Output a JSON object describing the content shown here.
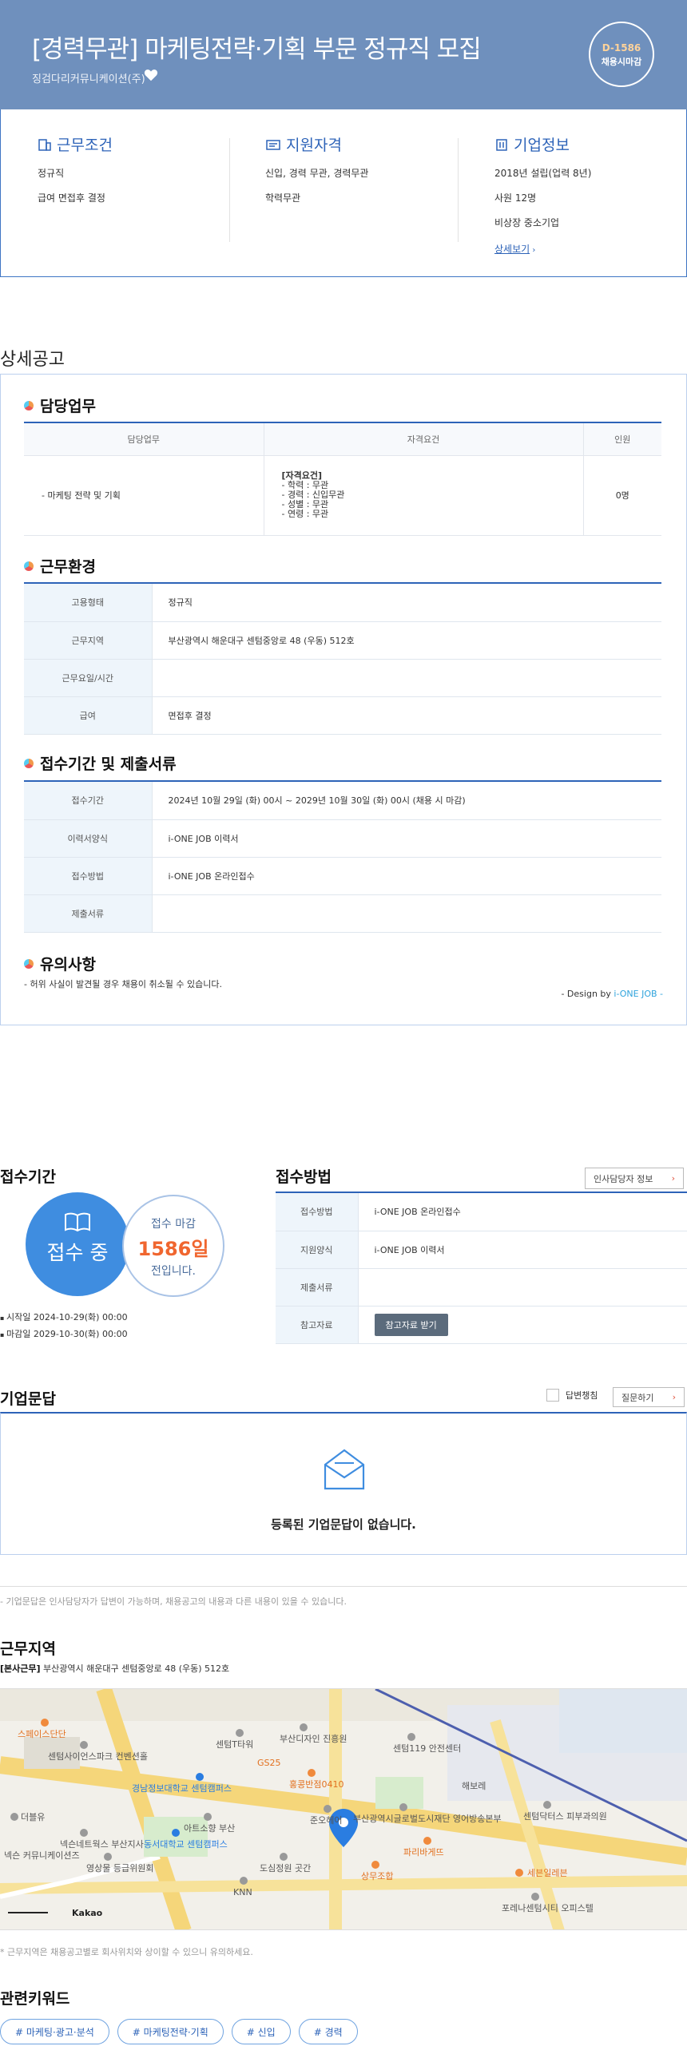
{
  "header": {
    "title": "[경력무관] 마케팅전략·기획 부문 정규직 모집",
    "company": "징검다리커뮤니케이션(주)",
    "dday": "D-1586",
    "dday_label": "채용시마감"
  },
  "summary": {
    "work": {
      "title": "근무조건",
      "lines": [
        "정규직",
        "급여 면접후 결정"
      ]
    },
    "qualification": {
      "title": "지원자격",
      "lines": [
        "신입, 경력 무관, 경력무관",
        "학력무관"
      ]
    },
    "company_info": {
      "title": "기업정보",
      "lines": [
        "2018년 설립(업력 8년)",
        "사원 12명",
        "비상장 중소기업"
      ],
      "link": "상세보기"
    }
  },
  "detail": {
    "section_title": "상세공고",
    "duties": {
      "title": "담당업무",
      "headers": [
        "담당업무",
        "자격요건",
        "인원"
      ],
      "row": {
        "duty": "- 마케팅 전략 및 기획",
        "req_title": "[자격요건]",
        "req_lines": [
          "- 학력 : 무관",
          "- 경력 : 신입무관",
          "- 성별 : 무관",
          "- 연령 : 무관"
        ],
        "count": "0명"
      }
    },
    "environment": {
      "title": "근무환경",
      "rows": [
        {
          "label": "고용형태",
          "value": "정규직"
        },
        {
          "label": "근무지역",
          "value": "부산광역시 해운대구 센텀중앙로 48 (우동) 512호"
        },
        {
          "label": "근무요일/시간",
          "value": ""
        },
        {
          "label": "급여",
          "value": "면접후 결정"
        }
      ]
    },
    "documents": {
      "title": "접수기간 및 제출서류",
      "rows": [
        {
          "label": "접수기간",
          "value": "2024년 10월 29일 (화) 00시 ~ 2029년 10월 30일 (화) 00시 (채용 시 마감)"
        },
        {
          "label": "이력서양식",
          "value": "i-ONE JOB 이력서"
        },
        {
          "label": "접수방법",
          "value": "i-ONE JOB 온라인접수"
        },
        {
          "label": "제출서류",
          "value": ""
        }
      ]
    },
    "caution": {
      "title": "유의사항",
      "text": "- 허위 사실이 발견될 경우 채용이 취소될 수 있습니다."
    },
    "design_prefix": "- Design by ",
    "design_brand": "i-ONE JOB -"
  },
  "apply": {
    "period_title": "접수기간",
    "status": "접수 중",
    "deadline_label": "접수 마감",
    "deadline_days": "1586일",
    "deadline_suffix": "전입니다.",
    "start": "시작일 2024-10-29(화) 00:00",
    "end": "마감일 2029-10-30(화) 00:00",
    "method_title": "접수방법",
    "contact_button": "인사담당자 정보",
    "rows": [
      {
        "label": "접수방법",
        "value": "i-ONE JOB 온라인접수"
      },
      {
        "label": "지원양식",
        "value": "i-ONE JOB 이력서"
      },
      {
        "label": "제출서류",
        "value": ""
      },
      {
        "label": "참고자료",
        "value": "참고자료 받기"
      }
    ]
  },
  "qa": {
    "title": "기업문답",
    "answered_only": "답변챙침",
    "ask_button": "질문하기",
    "empty": "등록된 기업문답이 없습니다.",
    "note": "- 기업문답은 인사담당자가 답변이 가능하며, 채용공고의 내용과 다른 내용이 있을 수 있습니다."
  },
  "location": {
    "title": "근무지역",
    "tag": "[본사근무]",
    "address": "부산광역시 해운대구 센텀중앙로 48 (우동) 512호",
    "map_note": "* 근무지역은 채용공고별로 회사위치와 상이할 수 있으니 유의하세요.",
    "map_labels": [
      "스페이스단단",
      "센텀사이언스파크 컨벤션홀",
      "센텀T타워",
      "부산디자인 진흥원",
      "경남정보대학교 센텀캠퍼스",
      "아트소향 부산",
      "센텀119 안전센터",
      "동서대학교 센텀캠퍼스",
      "넥슨네트웍스 부산지사",
      "더블유",
      "넥슨 커뮤니케이션즈",
      "영상물 등급위원회",
      "도심정원 곳간",
      "KNN",
      "홍콩반점0410",
      "준오헤어",
      "부산광역시글로벌도시재단 영어방송본부",
      "파리바게뜨",
      "상무조합",
      "세븐일레븐",
      "포레나센텀시티 오피스텔",
      "센텀닥터스 피부과의원",
      "해보레",
      "GS25",
      "Kakao"
    ]
  },
  "keywords": {
    "title": "관련키워드",
    "items": [
      "# 마케팅·광고·분석",
      "# 마케팅전략·기획",
      "# 신입",
      "# 경력"
    ]
  }
}
